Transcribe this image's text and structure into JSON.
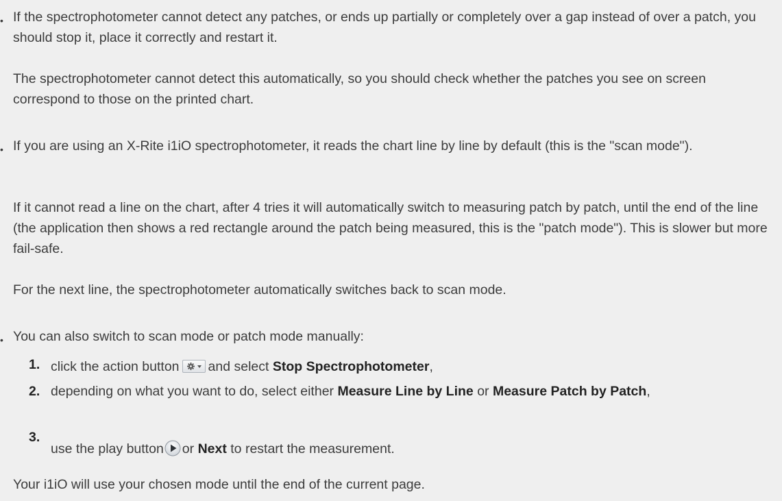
{
  "bullet_glyph": "•",
  "item1": {
    "para1": "If the spectrophotometer cannot detect any patches, or ends up partially or completely over a gap instead of over a patch, you should stop it, place it correctly and restart it.",
    "para2": "The spectrophotometer cannot detect this automatically, so you should check whether the patches you see on screen correspond to those on the printed chart."
  },
  "item2": {
    "para1": "If you are using an X-Rite i1iO spectrophotometer, it reads the chart line by line by default (this is the \"scan mode\").",
    "para2": "If it cannot read a line on the chart, after 4 tries it will automatically switch to measuring patch by patch, until the end of the line (the application then shows a red rectangle around the patch being measured, this is the \"patch mode\"). This is slower but more fail-safe.",
    "para3": "For the next line, the spectrophotometer automatically switches back to scan mode."
  },
  "item3": {
    "intro": "You can also switch to scan mode or patch mode manually:",
    "steps": [
      {
        "num": "1.",
        "text_a": "click the action button",
        "text_b": "and select",
        "bold_a": "Stop Spectrophotometer",
        "text_c": ","
      },
      {
        "num": "2.",
        "text_a": "depending on what you want to do, select either",
        "bold_a": "Measure Line by Line",
        "text_b": "or",
        "bold_b": "Measure Patch by Patch",
        "text_c": ","
      },
      {
        "num": "3.",
        "text_a": "use the play button",
        "text_b": "or",
        "bold_a": "Next",
        "text_c": "to restart the measurement."
      }
    ],
    "footer": "Your i1iO will use your chosen mode until the end of the current page."
  },
  "icons": {
    "action_button": "gear-dropdown-icon",
    "play_button": "play-circle-icon"
  }
}
